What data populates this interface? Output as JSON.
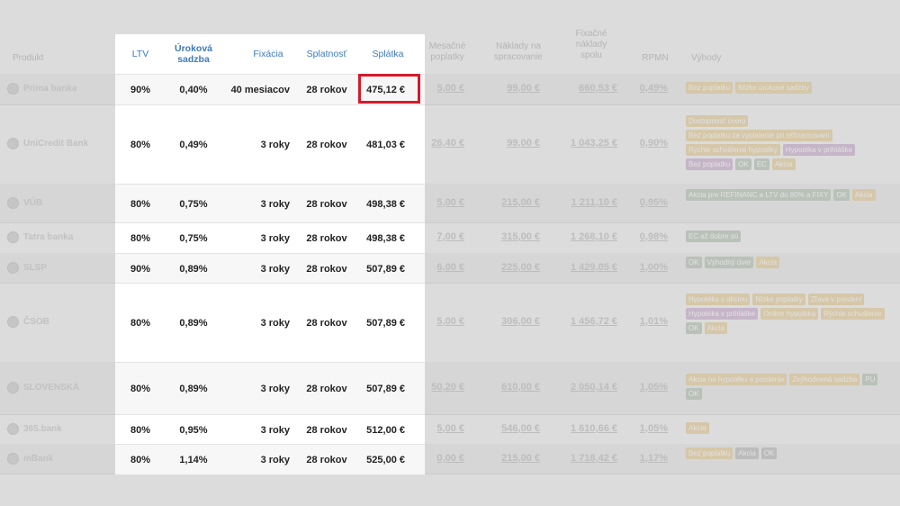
{
  "background": {
    "headers": {
      "product": "Produkt",
      "monthly_costs": "Mesačné poplatky",
      "processing_fee": "Náklady na spracovanie",
      "total_fixed": "Fixačné náklady spolu",
      "rpmn": "RPMN",
      "benefits": "Výhody"
    },
    "rows": [
      {
        "logo": "Prima banka",
        "monthly": "5,00 €",
        "processing": "99,00 €",
        "total": "660,53 €",
        "rpmn": "0,49%",
        "tags": [
          {
            "t": "Bez poplatku",
            "c": "o"
          },
          {
            "t": "Nízke úrokové sadzby",
            "c": "o"
          }
        ]
      },
      {
        "logo": "UniCredit Bank",
        "monthly": "26,40 €",
        "processing": "99,00 €",
        "total": "1 043,25 €",
        "rpmn": "0,90%",
        "tags": [
          {
            "t": "Dostupnosť úveru",
            "c": "o"
          },
          {
            "t": "Bez poplatku za vyplatenie pri refinancovaní",
            "c": "o"
          },
          {
            "t": "Rýchle schválenie hypotéky",
            "c": "o"
          },
          {
            "t": "Hypotéka v prihláške",
            "c": "p"
          },
          {
            "t": "Bez poplatku",
            "c": "p"
          },
          {
            "t": "OK",
            "c": "g"
          },
          {
            "t": "EC",
            "c": "g"
          },
          {
            "t": "Akcia",
            "c": "o"
          }
        ]
      },
      {
        "logo": "VÚB",
        "monthly": "5,00 €",
        "processing": "215,00 €",
        "total": "1 211,10 €",
        "rpmn": "0,95%",
        "tags": [
          {
            "t": "Akcia pre REFINANC a LTV do 80% a FIXY",
            "c": "g"
          },
          {
            "t": "OK",
            "c": "g"
          },
          {
            "t": "Akcia",
            "c": "o"
          }
        ]
      },
      {
        "logo": "Tatra banka",
        "monthly": "7,00 €",
        "processing": "315,00 €",
        "total": "1 268,10 €",
        "rpmn": "0,98%",
        "tags": [
          {
            "t": "EC až dobre sú",
            "c": "g"
          }
        ]
      },
      {
        "logo": "SLSP",
        "monthly": "6,00 €",
        "processing": "225,00 €",
        "total": "1 429,05 €",
        "rpmn": "1,00%",
        "tags": [
          {
            "t": "OK",
            "c": "g"
          },
          {
            "t": "Výhodný úver",
            "c": "g"
          },
          {
            "t": "Akcia",
            "c": "o"
          }
        ]
      },
      {
        "logo": "ČSOB",
        "monthly": "5,00 €",
        "processing": "306,00 €",
        "total": "1 456,72 €",
        "rpmn": "1,01%",
        "tags": [
          {
            "t": "Hypotéka s akciou",
            "c": "o"
          },
          {
            "t": "Nízke poplatky",
            "c": "o"
          },
          {
            "t": "Zľava v poistení",
            "c": "o"
          },
          {
            "t": "Hypotéka v prihláške",
            "c": "p"
          },
          {
            "t": "Online hypotéka",
            "c": "o"
          },
          {
            "t": "Rýchle schválenie",
            "c": "o"
          },
          {
            "t": "OK",
            "c": "g"
          },
          {
            "t": "Akcia",
            "c": "o"
          }
        ]
      },
      {
        "logo": "SLOVENSKÁ",
        "monthly": "50,20 €",
        "processing": "610,00 €",
        "total": "2 050,14 €",
        "rpmn": "1,05%",
        "tags": [
          {
            "t": "Akcia na hypotéku a poistenie",
            "c": "o"
          },
          {
            "t": "Zvýhodnená sadzba",
            "c": "o"
          },
          {
            "t": "PU",
            "c": "g"
          },
          {
            "t": "OK",
            "c": "g"
          }
        ]
      },
      {
        "logo": "365.bank",
        "monthly": "5,00 €",
        "processing": "546,00 €",
        "total": "1 610,66 €",
        "rpmn": "1,05%",
        "tags": [
          {
            "t": "Akcia",
            "c": "o"
          }
        ]
      },
      {
        "logo": "mBank",
        "monthly": "0,00 €",
        "processing": "215,00 €",
        "total": "1 718,42 €",
        "rpmn": "1,17%",
        "tags": [
          {
            "t": "Bez poplatku",
            "c": "o"
          },
          {
            "t": "Akcia",
            "c": "d"
          },
          {
            "t": "OK",
            "c": "d"
          }
        ]
      }
    ]
  },
  "panel": {
    "headers": {
      "ltv": "LTV",
      "rate_line1": "Úroková",
      "rate_line2": "sadzba",
      "fixation": "Fixácia",
      "maturity": "Splatnosť",
      "payment": "Splátka"
    },
    "rows": [
      {
        "ltv": "90%",
        "rate": "0,40%",
        "fixation": "40 mesiacov",
        "maturity": "28 rokov",
        "payment": "475,12 €"
      },
      {
        "ltv": "80%",
        "rate": "0,49%",
        "fixation": "3 roky",
        "maturity": "28 rokov",
        "payment": "481,03 €"
      },
      {
        "ltv": "80%",
        "rate": "0,75%",
        "fixation": "3 roky",
        "maturity": "28 rokov",
        "payment": "498,38 €"
      },
      {
        "ltv": "80%",
        "rate": "0,75%",
        "fixation": "3 roky",
        "maturity": "28 rokov",
        "payment": "498,38 €"
      },
      {
        "ltv": "90%",
        "rate": "0,89%",
        "fixation": "3 roky",
        "maturity": "28 rokov",
        "payment": "507,89 €"
      },
      {
        "ltv": "80%",
        "rate": "0,89%",
        "fixation": "3 roky",
        "maturity": "28 rokov",
        "payment": "507,89 €"
      },
      {
        "ltv": "80%",
        "rate": "0,89%",
        "fixation": "3 roky",
        "maturity": "28 rokov",
        "payment": "507,89 €"
      },
      {
        "ltv": "80%",
        "rate": "0,95%",
        "fixation": "3 roky",
        "maturity": "28 rokov",
        "payment": "512,00 €"
      },
      {
        "ltv": "80%",
        "rate": "1,14%",
        "fixation": "3 roky",
        "maturity": "28 rokov",
        "payment": "525,00 €"
      }
    ]
  },
  "colors": {
    "highlight_border": "#d6192b",
    "header_text": "#3c7ac0"
  }
}
